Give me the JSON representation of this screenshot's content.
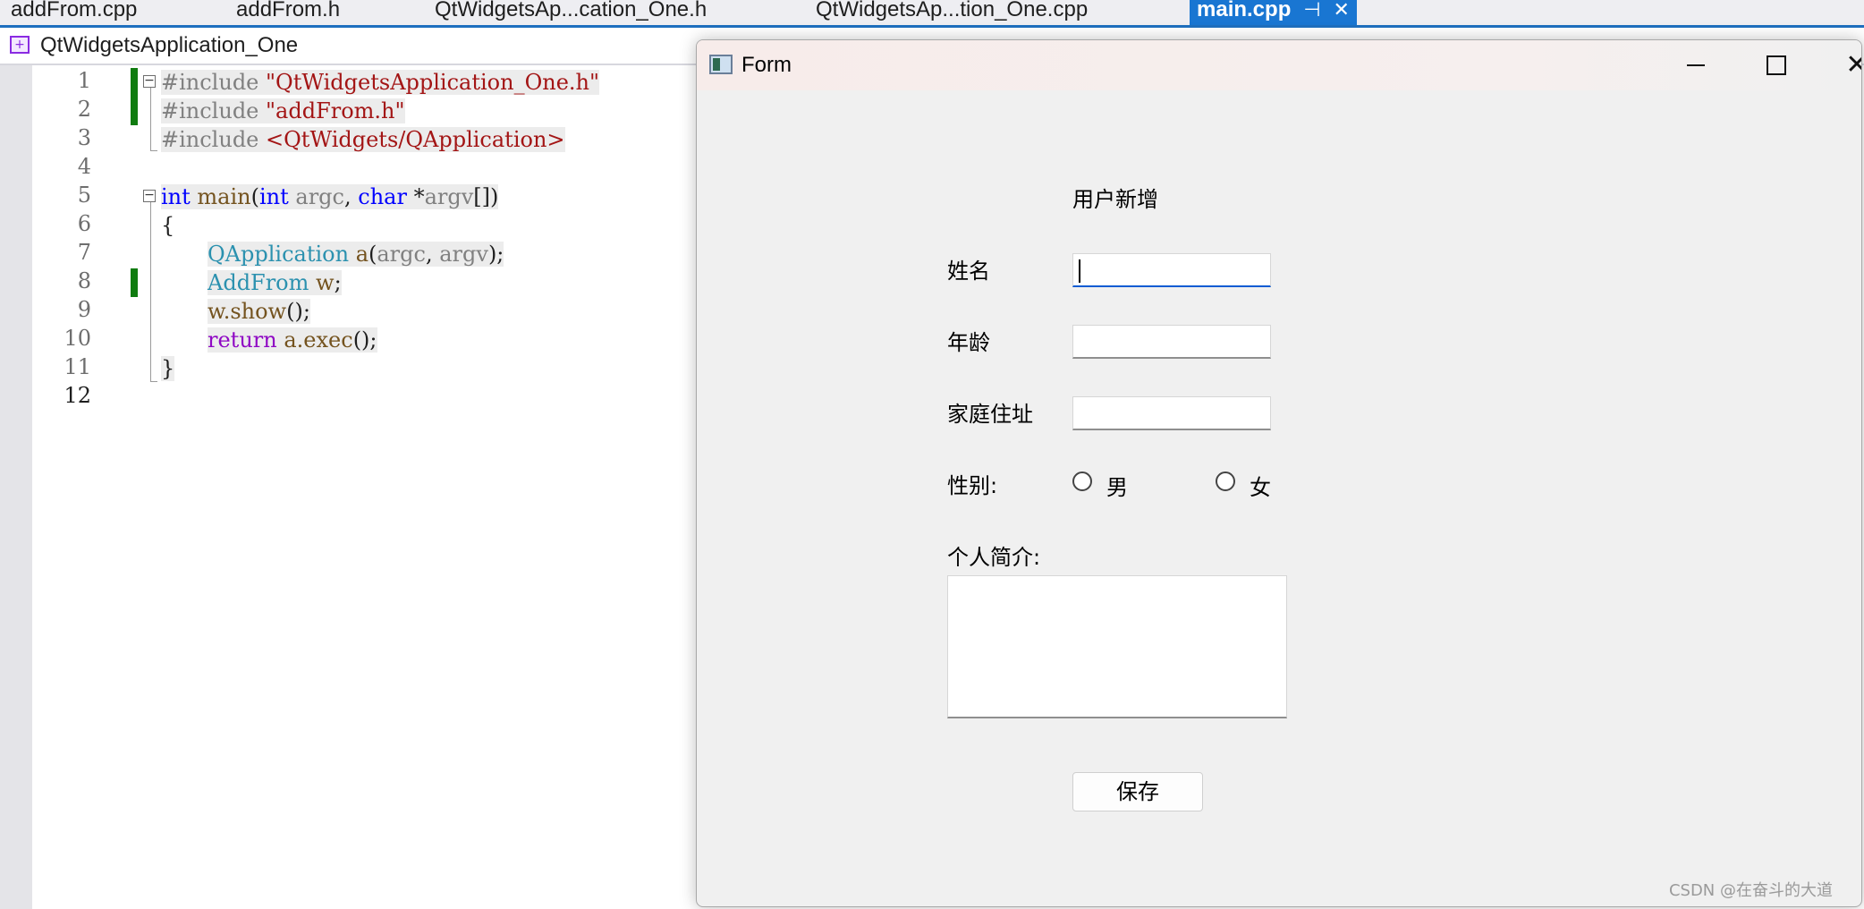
{
  "editor": {
    "tabs": [
      {
        "label": "addFrom.cpp"
      },
      {
        "label": "addFrom.h"
      },
      {
        "label": "QtWidgetsAp...cation_One.h"
      },
      {
        "label": "QtWidgetsAp...tion_One.cpp"
      },
      {
        "label": "main.cpp",
        "active": true
      }
    ],
    "tab_pin_icon": "pin-icon",
    "tab_close_icon": "close-icon",
    "project_name": "QtWidgetsApplication_One",
    "line_numbers": [
      "1",
      "2",
      "3",
      "4",
      "5",
      "6",
      "7",
      "8",
      "9",
      "10",
      "11",
      "12"
    ],
    "code": {
      "l1_directive": "#include ",
      "l1_arg": "\"QtWidgetsApplication_One.h\"",
      "l2_directive": "#include ",
      "l2_arg": "\"addFrom.h\"",
      "l3_directive": "#include ",
      "l3_arg": "<QtWidgets/QApplication>",
      "l5_int": "int",
      "l5_main": " main",
      "l5_paren": "(",
      "l5_int2": "int",
      "l5_argc": " argc",
      "l5_comma": ", ",
      "l5_char": "char",
      "l5_star": " *",
      "l5_argv": "argv",
      "l5_end": "[])",
      "l6": "{",
      "l7_type": "QApplication",
      "l7_var": " a",
      "l7_paren": "(",
      "l7_argc": "argc",
      "l7_comma": ", ",
      "l7_argv": "argv",
      "l7_end": ");",
      "l8_type": "AddFrom",
      "l8_var": " w",
      "l8_end": ";",
      "l9_obj": "w.",
      "l9_fn": "show",
      "l9_end": "();",
      "l10_kw": "return",
      "l10_obj": " a.",
      "l10_fn": "exec",
      "l10_end": "();",
      "l11": "}"
    }
  },
  "form": {
    "title": "Form",
    "window_icon": "qt-form-icon",
    "minimize_icon": "minimize-icon",
    "maximize_icon": "maximize-icon",
    "close_icon": "close-icon",
    "heading": "用户新增",
    "name_label": "姓名",
    "age_label": "年龄",
    "address_label": "家庭住址",
    "gender_label": "性别:",
    "gender_male": "男",
    "gender_female": "女",
    "intro_label": "个人简介:",
    "save_button": "保存",
    "name_value": "",
    "age_value": "",
    "address_value": "",
    "intro_value": ""
  },
  "watermark": "CSDN @在奋斗的大道",
  "colors": {
    "tab_active": "#1976d2",
    "change_marker": "#107c10",
    "keyword": "#0000ff",
    "string": "#a31515",
    "type": "#2b91af"
  }
}
